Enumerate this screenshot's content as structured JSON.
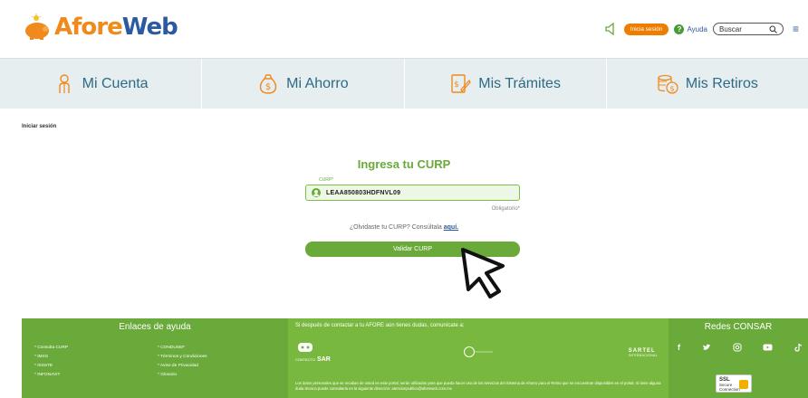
{
  "header": {
    "logo_afore": "Afore",
    "logo_web": "Web",
    "login_button": "Inicia sesión",
    "help_label": "Ayuda",
    "help_icon_glyph": "?",
    "search_placeholder": "Buscar",
    "menu_icon": "hamburger-icon"
  },
  "nav": {
    "items": [
      {
        "label": "Mi Cuenta",
        "icon": "person-icon"
      },
      {
        "label": "Mi Ahorro",
        "icon": "money-bag-icon"
      },
      {
        "label": "Mis Trámites",
        "icon": "document-pen-icon"
      },
      {
        "label": "Mis Retiros",
        "icon": "coins-icon"
      }
    ]
  },
  "breadcrumb": "Iniciar sesión",
  "form": {
    "title": "Ingresa tu CURP",
    "field_label": "CURP*",
    "curp_value": "LEAA850803HDFNVL09",
    "required_note": "Obligatorio*",
    "forgot_text": "¿Olvidaste tu CURP? Consúltala",
    "forgot_link": "aquí.",
    "submit_label": "Validar CURP"
  },
  "footer": {
    "help_title": "Enlaces de ayuda",
    "links": [
      "* Consulta CURP",
      "* CONDUSEF",
      "* IMSS",
      "* Términos y Condiciones",
      "* ISSSTE",
      "* Aviso de Privacidad",
      "* INFONAVIT",
      "* Glosario"
    ],
    "contact_heading": "Si después de contactar a tu AFORE aún tienes dudas, comunícate a:",
    "sar_logo": "SAR",
    "sar_prefix": "CONTACTO",
    "sartel_logo": "SARTEL",
    "sartel_sub": "INTERNACIONAL",
    "disclaimer": "Los datos personales que se recaban de usted en este portal, serán utilizados para que pueda hacer uso de los servicios del Sistema de Ahorro para el Retiro que se encuentran disponibles en el portal. Si tiene alguna duda técnica puede consultarla en la siguiente dirección: atencionpublico@aforeweb.com.mx",
    "social_title": "Redes CONSAR",
    "social_icons": [
      "f",
      "twitter-icon",
      "instagram-icon",
      "youtube-icon",
      "tiktok-icon"
    ],
    "ssl_title": "SSL",
    "ssl_line1": "Secure",
    "ssl_line2": "Connection"
  },
  "colors": {
    "brand_orange": "#ef7d00",
    "brand_blue": "#2c5aa0",
    "brand_green": "#6aaa3a"
  }
}
